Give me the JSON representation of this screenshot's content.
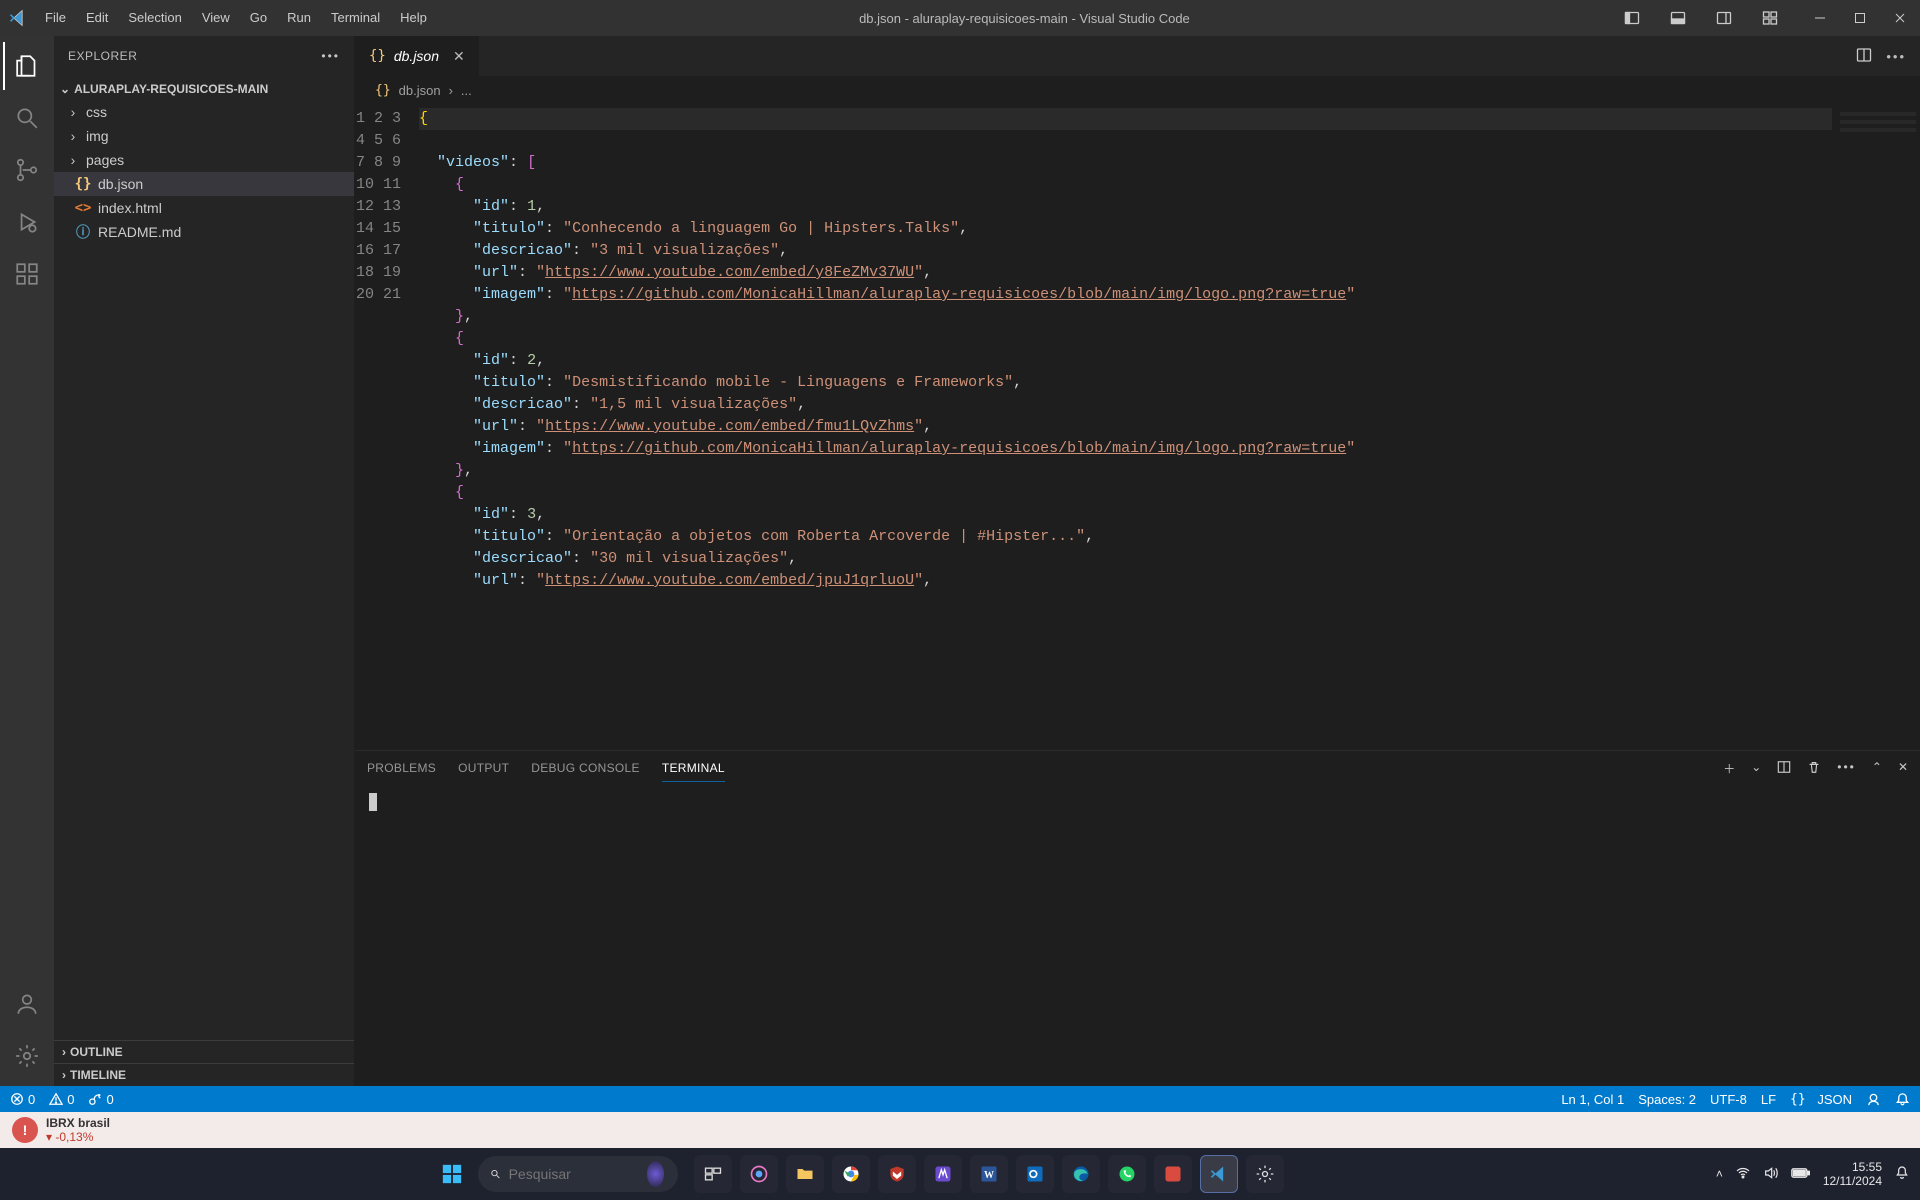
{
  "titlebar": {
    "menus": [
      "File",
      "Edit",
      "Selection",
      "View",
      "Go",
      "Run",
      "Terminal",
      "Help"
    ],
    "title": "db.json - aluraplay-requisicoes-main - Visual Studio Code"
  },
  "activity": {
    "items": [
      "explorer",
      "search",
      "source-control",
      "run-debug",
      "extensions"
    ],
    "bottom": [
      "accounts",
      "manage"
    ]
  },
  "sidebar": {
    "title": "EXPLORER",
    "root": "ALURAPLAY-REQUISICOES-MAIN",
    "files": [
      {
        "name": "css",
        "type": "folder"
      },
      {
        "name": "img",
        "type": "folder"
      },
      {
        "name": "pages",
        "type": "folder"
      },
      {
        "name": "db.json",
        "type": "json",
        "selected": true
      },
      {
        "name": "index.html",
        "type": "html"
      },
      {
        "name": "README.md",
        "type": "md"
      }
    ],
    "outline": "OUTLINE",
    "timeline": "TIMELINE"
  },
  "tab": {
    "label": "db.json"
  },
  "breadcrumbs": {
    "file": "db.json",
    "rest": "..."
  },
  "code_lines": [
    "{",
    "  \"videos\": [",
    "    {",
    "      \"id\": 1,",
    "      \"titulo\": \"Conhecendo a linguagem Go | Hipsters.Talks\",",
    "      \"descricao\": \"3 mil visualizações\",",
    "      \"url\": \"https://www.youtube.com/embed/y8FeZMv37WU\",",
    "      \"imagem\": \"https://github.com/MonicaHillman/aluraplay-requisicoes/blob/main/img/logo.png?raw=true\"",
    "    },",
    "    {",
    "      \"id\": 2,",
    "      \"titulo\": \"Desmistificando mobile - Linguagens e Frameworks\",",
    "      \"descricao\": \"1,5 mil visualizações\",",
    "      \"url\": \"https://www.youtube.com/embed/fmu1LQvZhms\",",
    "      \"imagem\": \"https://github.com/MonicaHillman/aluraplay-requisicoes/blob/main/img/logo.png?raw=true\"",
    "    },",
    "    {",
    "      \"id\": 3,",
    "      \"titulo\": \"Orientação a objetos com Roberta Arcoverde | #Hipster...\",",
    "      \"descricao\": \"30 mil visualizações\",",
    "      \"url\": \"https://www.youtube.com/embed/jpuJ1qrluoU\","
  ],
  "panel": {
    "tabs": [
      "PROBLEMS",
      "OUTPUT",
      "DEBUG CONSOLE",
      "TERMINAL"
    ],
    "active": 3
  },
  "status": {
    "errors": "0",
    "warnings": "0",
    "ports": "0",
    "pos": "Ln 1, Col 1",
    "spaces": "Spaces: 2",
    "enc": "UTF-8",
    "eol": "LF",
    "lang": "JSON"
  },
  "stock": {
    "name": "IBRX brasil",
    "chg": "-0,13%"
  },
  "taskbar": {
    "search_placeholder": "Pesquisar",
    "clock": {
      "time": "15:55",
      "date": "12/11/2024"
    }
  }
}
